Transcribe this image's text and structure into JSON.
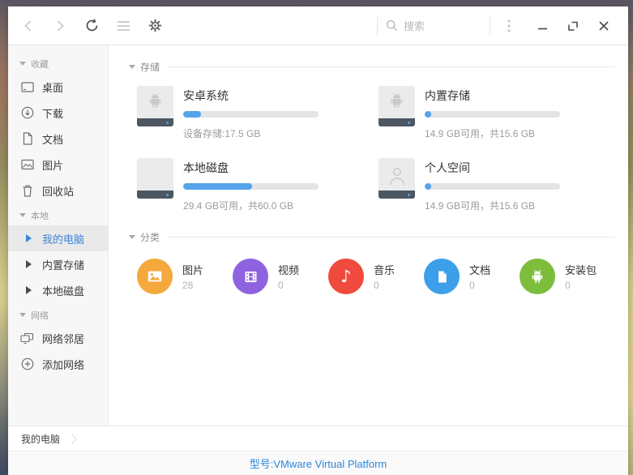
{
  "toolbar": {
    "search_placeholder": "搜索"
  },
  "sidebar": {
    "sections": [
      {
        "label": "收藏",
        "items": [
          {
            "label": "桌面",
            "icon": "desktop-icon"
          },
          {
            "label": "下载",
            "icon": "download-icon"
          },
          {
            "label": "文档",
            "icon": "document-icon"
          },
          {
            "label": "图片",
            "icon": "image-icon"
          },
          {
            "label": "回收站",
            "icon": "trash-icon"
          }
        ]
      },
      {
        "label": "本地",
        "items": [
          {
            "label": "我的电脑",
            "icon": "expand-triangle-icon",
            "selected": true
          },
          {
            "label": "内置存储",
            "icon": "expand-triangle-icon",
            "selected": false
          },
          {
            "label": "本地磁盘",
            "icon": "expand-triangle-icon",
            "selected": false
          }
        ]
      },
      {
        "label": "网络",
        "items": [
          {
            "label": "网络邻居",
            "icon": "network-computers-icon"
          },
          {
            "label": "添加网络",
            "icon": "add-circle-icon"
          }
        ]
      }
    ]
  },
  "storage": {
    "header": "存储",
    "items": [
      {
        "name": "安卓系统",
        "detail": "设备存储:17.5 GB",
        "percent": 13,
        "icon": "android-drive-icon"
      },
      {
        "name": "内置存储",
        "detail": "14.9 GB可用，共15.6 GB",
        "percent": 5,
        "icon": "android-drive-icon"
      },
      {
        "name": "本地磁盘",
        "detail": "29.4 GB可用，共60.0 GB",
        "percent": 51,
        "icon": "disk-drive-icon"
      },
      {
        "name": "个人空间",
        "detail": "14.9 GB可用，共15.6 GB",
        "percent": 5,
        "icon": "user-drive-icon"
      }
    ],
    "bar_color": "#55a3ea"
  },
  "categories": {
    "header": "分类",
    "items": [
      {
        "label": "图片",
        "count": "28",
        "color": "#f5a93d",
        "icon": "pictures-icon"
      },
      {
        "label": "视频",
        "count": "0",
        "color": "#8f63e0",
        "icon": "videos-icon"
      },
      {
        "label": "音乐",
        "count": "0",
        "color": "#ef4a3d",
        "icon": "music-icon"
      },
      {
        "label": "文档",
        "count": "0",
        "color": "#3d9fe9",
        "icon": "documents-icon"
      },
      {
        "label": "安装包",
        "count": "0",
        "color": "#7cbd3c",
        "icon": "apk-icon"
      }
    ]
  },
  "breadcrumb": {
    "current": "我的电脑"
  },
  "statusbar": {
    "text": "型号:VMware Virtual Platform",
    "color": "#2b87d8"
  },
  "accent_color": "#3c87db"
}
